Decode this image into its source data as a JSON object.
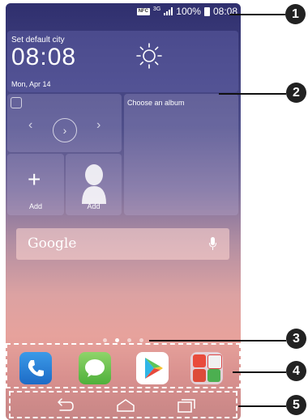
{
  "status_bar": {
    "nfc_label": "NFC",
    "network_type": "3G",
    "battery": "100%",
    "time": "08:08"
  },
  "weather_widget": {
    "city": "Set default city",
    "time": "08:08",
    "date": "Mon, Apr 14",
    "icon": "sun-icon"
  },
  "gallery_widget": {
    "album_prompt": "Choose an album"
  },
  "contact_widgets": [
    {
      "label": "Add"
    },
    {
      "label": "Add"
    }
  ],
  "search_widget": {
    "brand": "Google"
  },
  "page_indicator": {
    "count": 4,
    "active": 2
  },
  "dock_apps": [
    {
      "name": "Phone",
      "icon": "phone-icon"
    },
    {
      "name": "Messaging",
      "icon": "message-icon"
    },
    {
      "name": "Play Store",
      "icon": "play-store-icon"
    },
    {
      "name": "Google folder",
      "icon": "folder-icon"
    }
  ],
  "nav_bar": {
    "buttons": [
      "back",
      "home",
      "recent"
    ]
  },
  "callouts": [
    "1",
    "2",
    "3",
    "4",
    "5"
  ]
}
